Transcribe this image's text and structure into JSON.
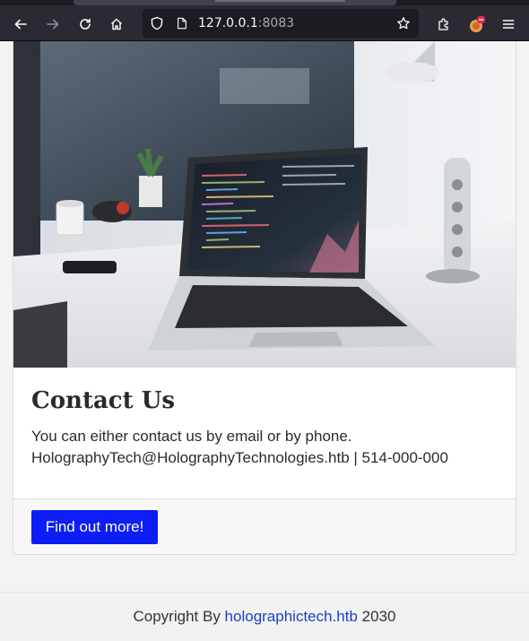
{
  "browser": {
    "url_host": "127.0.0.1",
    "url_port": ":8083",
    "icons": [
      "back-icon",
      "forward-icon",
      "reload-icon",
      "home-icon",
      "shield-icon",
      "page-icon",
      "bookmark-star-icon",
      "extensions-icon",
      "profile-avatar-icon",
      "menu-icon"
    ]
  },
  "card": {
    "image_alt": "Laptop on desk with code editor open",
    "title": "Contact Us",
    "line1": "You can either contact us by email or by phone.",
    "line2": "HolographyTech@HolographyTechnologies.htb | 514-000-000",
    "button_label": "Find out more!"
  },
  "footer": {
    "prefix": "Copyright By ",
    "link": "holographictech.htb",
    "suffix": " 2030"
  },
  "colors": {
    "accent": "#0d1ef5",
    "link": "#1a3fc9",
    "chrome": "#2b2a33"
  }
}
